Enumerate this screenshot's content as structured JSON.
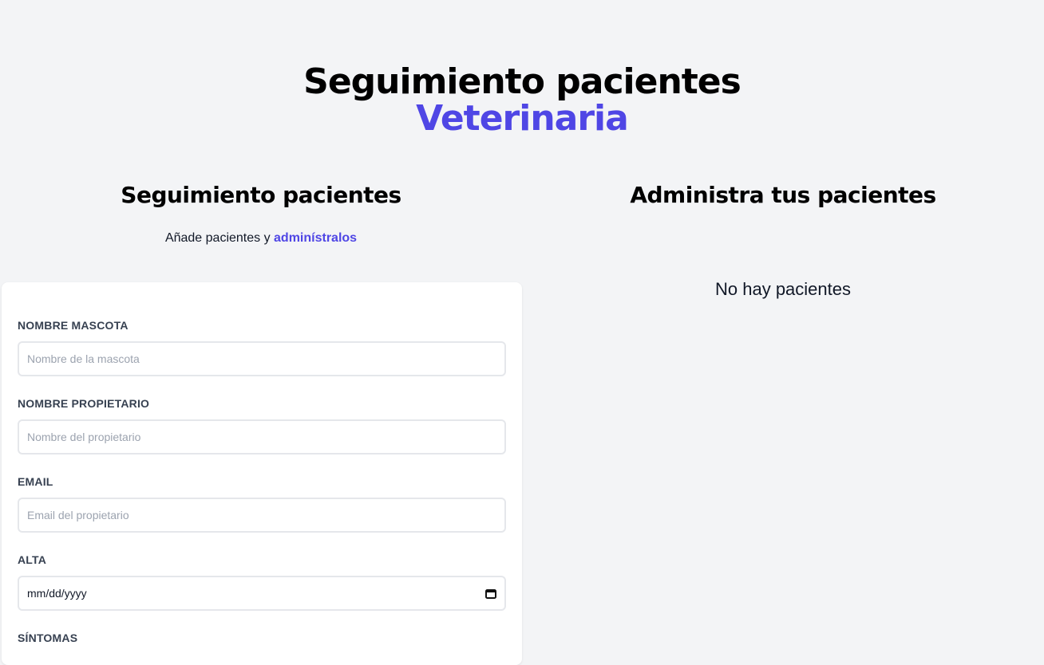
{
  "header": {
    "title": "Seguimiento pacientes",
    "subtitle": "Veterinaria"
  },
  "form_section": {
    "title": "Seguimiento pacientes",
    "lead_text": "Añade pacientes y ",
    "lead_accent": "adminístralos",
    "fields": [
      {
        "label": "NOMBRE MASCOTA",
        "placeholder": "Nombre de la mascota"
      },
      {
        "label": "NOMBRE PROPIETARIO",
        "placeholder": "Nombre del propietario"
      },
      {
        "label": "EMAIL",
        "placeholder": "Email del propietario"
      },
      {
        "label": "ALTA",
        "value": "mm/dd/yyyy"
      },
      {
        "label": "SÍNTOMAS"
      }
    ]
  },
  "list_section": {
    "title": "Administra tus pacientes",
    "empty_message": "No hay pacientes"
  },
  "colors": {
    "accent": "#4f46e5",
    "background": "#f3f4f6",
    "card": "#ffffff"
  }
}
